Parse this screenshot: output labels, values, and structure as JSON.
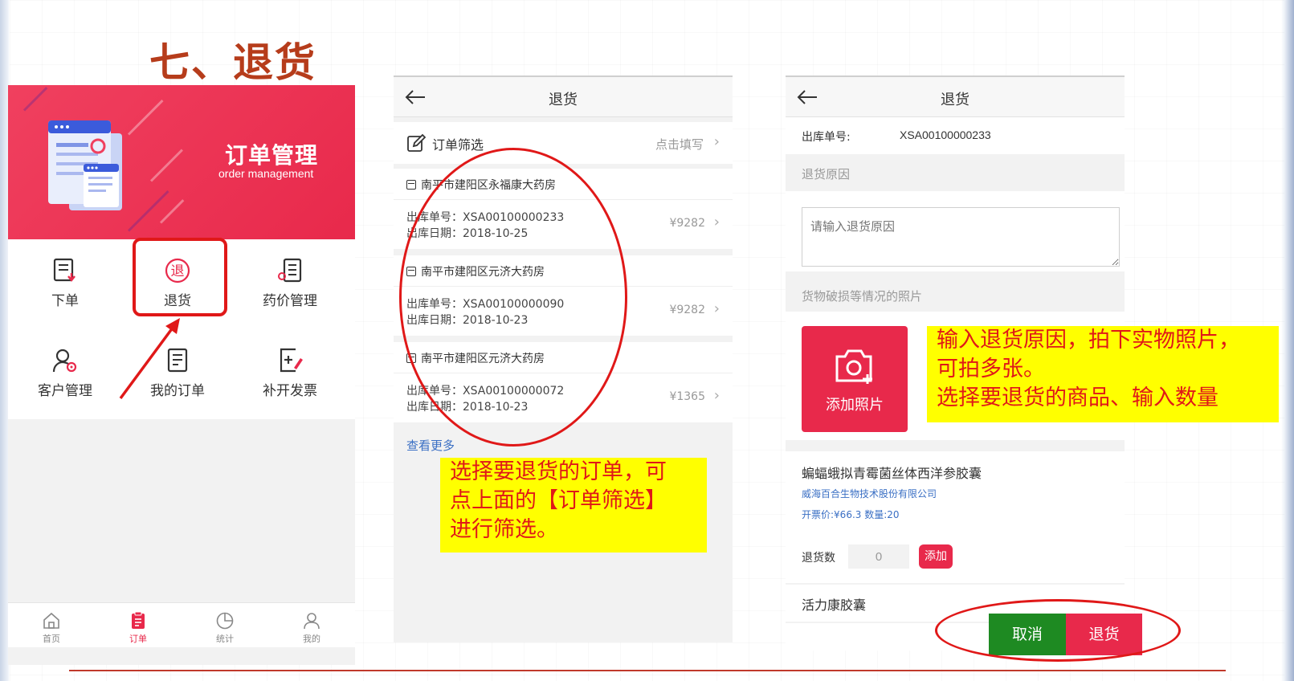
{
  "slide": {
    "title": "七、退货"
  },
  "panel1": {
    "banner": {
      "title": "订单管理",
      "subtitle": "order management"
    },
    "grid": [
      {
        "label": "下单",
        "icon": "new-order-icon"
      },
      {
        "label": "退货",
        "icon": "return-icon"
      },
      {
        "label": "药价管理",
        "icon": "price-list-icon"
      },
      {
        "label": "客户管理",
        "icon": "customer-settings-icon"
      },
      {
        "label": "我的订单",
        "icon": "my-orders-icon"
      },
      {
        "label": "补开发票",
        "icon": "invoice-edit-icon"
      }
    ],
    "tabs": [
      {
        "label": "首页",
        "icon": "home-icon"
      },
      {
        "label": "订单",
        "icon": "clipboard-icon",
        "active": true
      },
      {
        "label": "统计",
        "icon": "pie-chart-icon"
      },
      {
        "label": "我的",
        "icon": "user-icon"
      }
    ]
  },
  "panel2": {
    "nav_title": "退货",
    "filter": {
      "label": "订单筛选",
      "hint": "点击填写"
    },
    "orders": [
      {
        "shop": "南平市建阳区永福康大药房",
        "no": "出库单号：XSA00100000233",
        "date": "出库日期：2018-10-25",
        "amount": "¥9282"
      },
      {
        "shop": "南平市建阳区元济大药房",
        "no": "出库单号：XSA00100000090",
        "date": "出库日期：2018-10-23",
        "amount": "¥9282"
      },
      {
        "shop": "南平市建阳区元济大药房",
        "no": "出库单号：XSA00100000072",
        "date": "出库日期：2018-10-23",
        "amount": "¥1365"
      }
    ],
    "more": "查看更多",
    "note_lines": [
      "选择要退货的订单，可",
      "点上面的【订单筛选】",
      "进行筛选。"
    ]
  },
  "panel3": {
    "nav_title": "退货",
    "outbound_label": "出库单号:",
    "outbound_value": "XSA00100000233",
    "reason_title": "退货原因",
    "reason_placeholder": "请输入退货原因",
    "photo_title": "货物破损等情况的照片",
    "add_photo": "添加照片",
    "product": {
      "name": "蝙蝠蛾拟青霉菌丝体西洋参胶囊",
      "company": "威海百合生物技术股份有限公司",
      "price": "开票价:¥66.3 数量:20",
      "qty_label": "退货数",
      "qty_value": "0",
      "add_label": "添加"
    },
    "product2_name": "活力康胶囊",
    "cancel": "取消",
    "confirm": "退货",
    "note_lines": [
      "输入退货原因，拍下实物照片，",
      "可拍多张。",
      "选择要退货的商品、输入数量"
    ]
  },
  "colors": {
    "brand": "#e8294b",
    "annotation": "#e01818",
    "note_bg": "#ffff00",
    "cancel_green": "#1e8a22",
    "title": "#b63c1b"
  }
}
